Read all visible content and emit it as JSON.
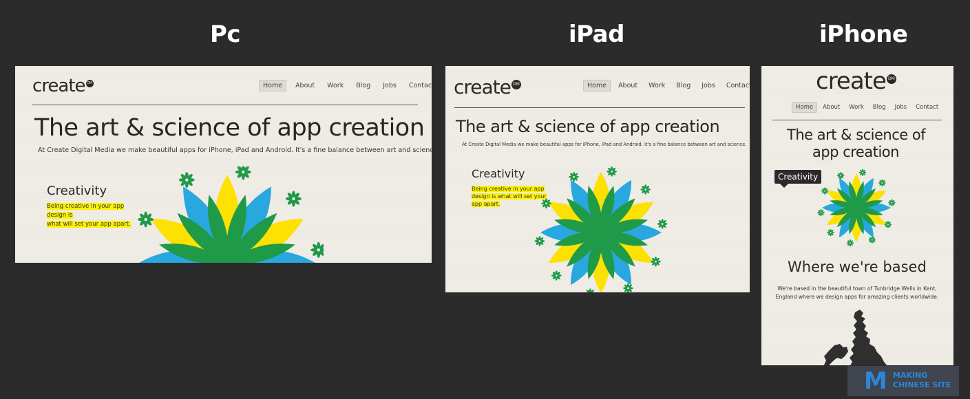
{
  "labels": {
    "pc": "Pc",
    "ipad": "iPad",
    "iphone": "iPhone"
  },
  "brand": {
    "name": "create",
    "badge": "DM"
  },
  "nav": [
    "Home",
    "About",
    "Work",
    "Blog",
    "Jobs",
    "Contact"
  ],
  "headline": "The art & science of app creation",
  "headline_mobile_line1": "The art & science of",
  "headline_mobile_line2": "app creation",
  "intro": "At Create Digital Media we make beautiful apps for iPhone, iPad and Android. It's a fine balance between art and science.",
  "creativity": {
    "title": "Creativity",
    "text": "Being creative in your app design is what will set your app apart.",
    "text_pc_line1": "Being creative in your app design is",
    "text_pc_line2": "what will set your app apart.",
    "text_ipad_line1": "Being creative in your app",
    "text_ipad_line2": "design is what will set your",
    "text_ipad_line3": "app apart."
  },
  "location": {
    "title": "Where we're based",
    "text_line1": "We're based in the beautiful town of Tunbridge Wells in Kent,",
    "text_line2": "England where we design apps for amazing clients worldwide."
  },
  "colors": {
    "blue": "#29a8e0",
    "yellow": "#fde100",
    "green": "#1f9a48",
    "bg": "#efede6"
  },
  "watermark": {
    "logo": "M",
    "line1": "MAKING",
    "line2": "CHINESE SITE"
  }
}
